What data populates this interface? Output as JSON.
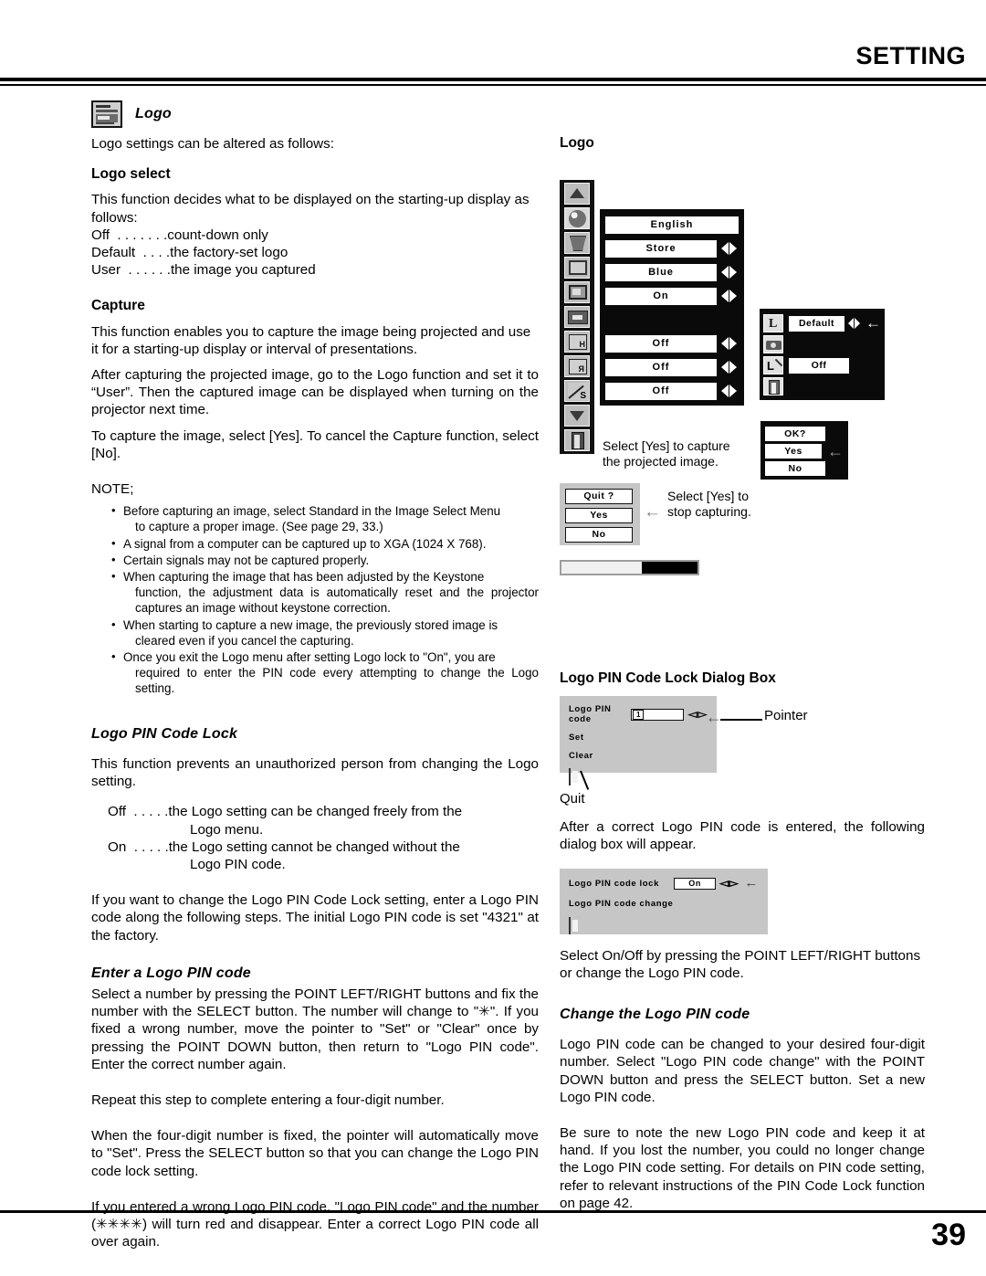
{
  "header": {
    "title": "SETTING"
  },
  "footer": {
    "page_number": "39"
  },
  "left": {
    "logo_heading": "Logo",
    "logo_icon_name": "logo-thumbnail-icon",
    "intro": "Logo settings can be altered as follows:",
    "logo_select": {
      "title": "Logo select",
      "p1": "This function decides what to be displayed on the starting-up display as follows:",
      "options": [
        {
          "name": "Off",
          "dots": "  . . . . . . .",
          "desc": "count-down only"
        },
        {
          "name": "Default",
          "dots": "  . . . .",
          "desc": "the factory-set logo"
        },
        {
          "name": "User",
          "dots": "  . . . . . .",
          "desc": "the image you captured"
        }
      ]
    },
    "capture": {
      "title": "Capture",
      "p1": "This function enables you to capture the image being projected and use it for a starting-up display or interval of presentations.",
      "p2": "After capturing the projected image, go to the Logo function and set it to “User”.  Then the captured image can be displayed when turning on the projector next time.",
      "p3": "To capture the image, select [Yes].  To cancel the Capture function, select [No].",
      "note_label": "NOTE;",
      "notes": [
        {
          "main": "Before capturing an image, select Standard in the Image Select Menu",
          "cont": "to capture a proper image.  (See page 29, 33.)"
        },
        {
          "main": "A signal from a computer can be captured up to XGA (1024 X 768).",
          "cont": ""
        },
        {
          "main": "Certain signals may not be captured properly.",
          "cont": ""
        },
        {
          "main": "When capturing the image that has been adjusted by the Keystone",
          "cont": "function, the adjustment data is automatically reset and the projector captures an image without keystone correction."
        },
        {
          "main": "When starting to capture a new image, the previously stored image is",
          "cont": "cleared even if you cancel the capturing."
        },
        {
          "main": "Once you exit the Logo menu after setting Logo lock to \"On\", you are",
          "cont": "required to enter the PIN code every attempting to change the Logo setting."
        }
      ]
    },
    "pin_lock": {
      "title": "Logo PIN Code Lock",
      "p1": "This function prevents an unauthorized person from changing the Logo setting.",
      "options": [
        {
          "name": "Off",
          "dots": "  . . . . .",
          "desc": "the Logo setting can be changed freely from the",
          "cont": "Logo menu."
        },
        {
          "name": "On",
          "dots": "  . . . . .",
          "desc": "the Logo setting cannot be changed without the",
          "cont": "Logo PIN code."
        }
      ],
      "p2": "If you want to change the Logo PIN Code Lock setting, enter a Logo PIN code along the following steps. The initial Logo PIN code is set \"4321\" at the factory."
    },
    "enter_pin": {
      "title": "Enter a Logo PIN code",
      "p1": "Select a number by pressing the POINT LEFT/RIGHT buttons and fix the number with the SELECT button.  The number will change to \"✳\".  If you fixed a wrong number, move the pointer to \"Set\" or \"Clear\" once by pressing the POINT DOWN button, then return to \"Logo PIN code\".  Enter the correct number again.",
      "p2": "Repeat this step to complete entering a four-digit number.",
      "p3": "When the four-digit number is fixed, the pointer will automatically move to \"Set\".  Press the SELECT button so that you can change the Logo PIN code lock setting.",
      "p4": "If you entered a wrong Logo PIN code, \"Logo PIN code\" and the number (✳✳✳✳) will turn red and disappear.  Enter a correct Logo PIN code all over again."
    }
  },
  "right": {
    "osd_label": "Logo",
    "main_menu": {
      "rail_icons": [
        "scroll-up-icon",
        "language-globe-icon",
        "keystone-icon",
        "blue-back-screen-icon",
        "display-logo-icon",
        "ceiling-icon",
        "rear-icon",
        "no-show-icon",
        "scroll-down-icon",
        "quit-door-icon"
      ],
      "rows": [
        {
          "value": "English",
          "arrows": false
        },
        {
          "value": "Store",
          "arrows": true
        },
        {
          "value": "Blue",
          "arrows": true
        },
        {
          "value": "On",
          "arrows": true
        },
        {
          "value": "",
          "arrows": false
        },
        {
          "value": "Off",
          "arrows": true
        },
        {
          "value": "Off",
          "arrows": true
        },
        {
          "value": "Off",
          "arrows": true
        }
      ]
    },
    "logo_submenu": {
      "rows": [
        {
          "icon": "logo-select-L-icon",
          "value": "Default",
          "arrows": true,
          "pointer": true
        },
        {
          "icon": "capture-camera-icon",
          "value": "",
          "arrows": false,
          "pointer": false
        },
        {
          "icon": "logo-pin-lock-icon",
          "value": "Off",
          "arrows": false,
          "pointer": false
        },
        {
          "icon": "quit-door-icon",
          "value": "",
          "arrows": false,
          "pointer": false
        }
      ]
    },
    "ok_dialog": {
      "title": "OK?",
      "yes": "Yes",
      "no": "No"
    },
    "capture_caption": "Select [Yes] to capture\nthe projected image.",
    "quit_dialog": {
      "title": "Quit ?",
      "yes": "Yes",
      "no": "No",
      "caption": "Select [Yes] to\nstop capturing."
    },
    "progress": {
      "percent": 60
    },
    "pin_dialog": {
      "title": "Logo PIN Code Lock Dialog Box",
      "field_label": "Logo PIN code",
      "field_value": "1",
      "set_label": "Set",
      "clear_label": "Clear",
      "pointer_label": "Pointer",
      "quit_label": "Quit",
      "after_text": "After a correct Logo PIN code is entered, the following dialog box will appear."
    },
    "lock_dialog": {
      "row1_label": "Logo PIN code lock",
      "row1_value": "On",
      "row2_label": "Logo PIN code change",
      "after_text": "Select On/Off by pressing the POINT LEFT/RIGHT buttons or change the Logo PIN code."
    },
    "change_pin": {
      "title": "Change the Logo PIN code",
      "p1": "Logo PIN code can be changed to your desired four-digit number. Select \"Logo PIN code change\" with the POINT DOWN button and press the SELECT button. Set a new Logo PIN code.",
      "p2": "Be sure to note the new Logo PIN code and keep it at hand.  If you lost the number, you could no longer change the Logo PIN code setting.  For details on PIN code setting, refer to relevant instructions of the PIN Code Lock function on page 42."
    }
  },
  "colors": {
    "osd_black": "#0a0a0a",
    "osd_gray": "#c6c6c6",
    "ink": "#000000"
  }
}
